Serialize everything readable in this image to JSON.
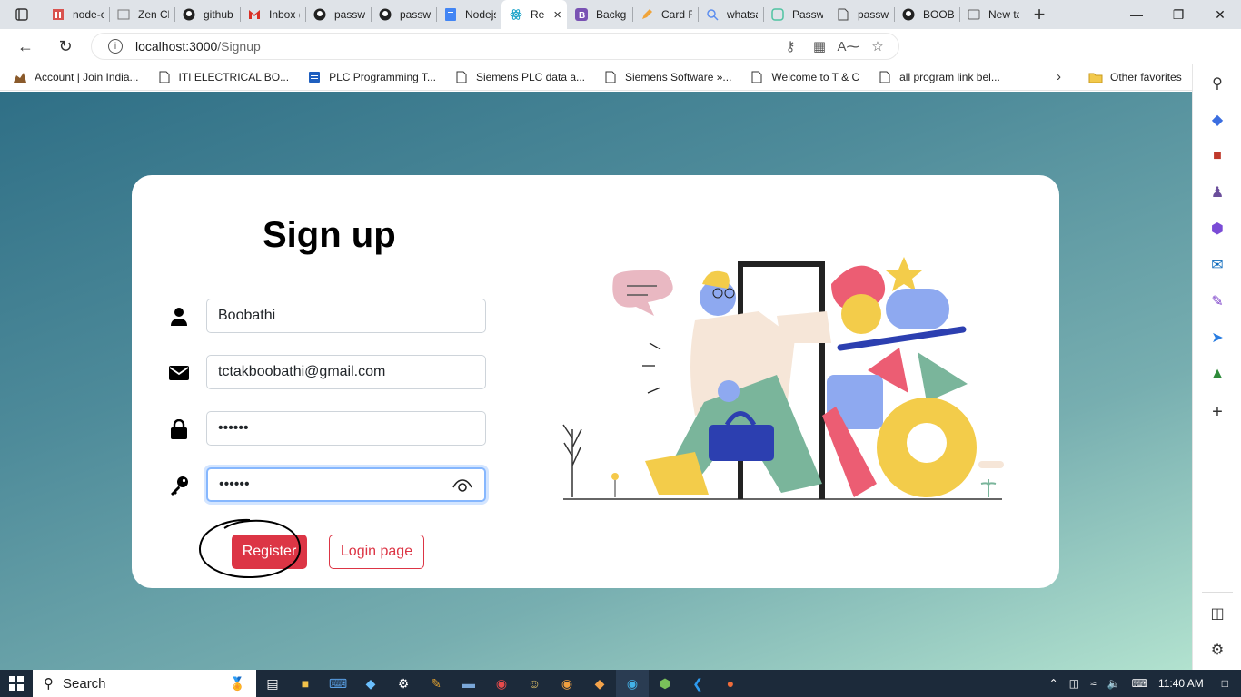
{
  "browser": {
    "tabs": [
      {
        "label": "node-c",
        "icon": "red-square-icon"
      },
      {
        "label": "Zen Cl",
        "icon": "page-icon"
      },
      {
        "label": "github",
        "icon": "github-icon"
      },
      {
        "label": "Inbox (",
        "icon": "gmail-icon"
      },
      {
        "label": "passwo",
        "icon": "github-icon"
      },
      {
        "label": "passwo",
        "icon": "github-icon"
      },
      {
        "label": "Nodejs",
        "icon": "docs-icon"
      },
      {
        "label": "Re",
        "icon": "react-icon",
        "active": true
      },
      {
        "label": "Backgr",
        "icon": "bootstrap-icon"
      },
      {
        "label": "Card Fi",
        "icon": "pen-icon"
      },
      {
        "label": "whatsa",
        "icon": "search-icon"
      },
      {
        "label": "Passwo",
        "icon": "code-icon"
      },
      {
        "label": "passwo",
        "icon": "file-icon"
      },
      {
        "label": "BOOBA",
        "icon": "github-icon"
      },
      {
        "label": "New ta",
        "icon": "newtab-icon"
      }
    ],
    "url_host": "localhost:3000",
    "url_path": "/Signup",
    "bookmarks": [
      "Account | Join India...",
      "ITI ELECTRICAL BO...",
      "PLC Programming T...",
      "Siemens PLC data a...",
      "Siemens Software »...",
      "Welcome to T & C",
      "all program link bel..."
    ],
    "other_favorites": "Other favorites"
  },
  "form": {
    "title": "Sign up",
    "name_value": "Boobathi",
    "email_value": "tctakboobathi@gmail.com",
    "password_value": "••••••",
    "confirm_value": "••••••",
    "register_label": "Register",
    "login_label": "Login page"
  },
  "taskbar": {
    "search_label": "Search",
    "time": "11:40 AM"
  },
  "colors": {
    "primary_red": "#dc3545",
    "bg_gradient_start": "#2f6f86",
    "bg_gradient_end": "#b2e2cf"
  }
}
